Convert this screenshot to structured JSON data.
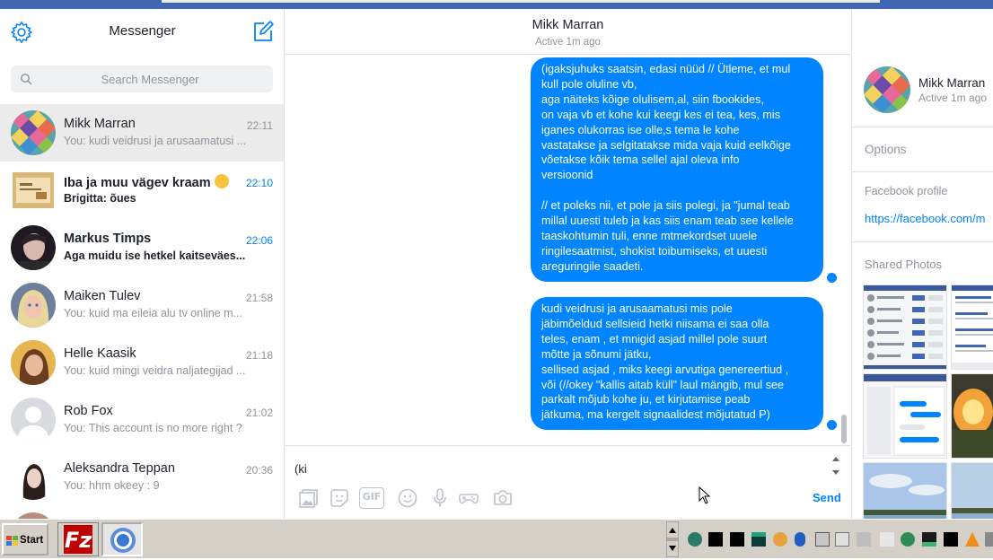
{
  "sidebar": {
    "title": "Messenger",
    "search_placeholder": "Search Messenger",
    "conversations": [
      {
        "name": "Mikk Marran",
        "snippet": "You: kudi veidrusi ja arusaamatusi ...",
        "time": "22:11",
        "selected": true,
        "unread": false
      },
      {
        "name": "Iba ja muu vägev kraam",
        "snippet": "Brigitta: õues",
        "time": "22:10",
        "selected": false,
        "unread": true
      },
      {
        "name": "Markus Timps",
        "snippet": "Aga muidu ise hetkel kaitseväes...",
        "time": "22:06",
        "selected": false,
        "unread": true
      },
      {
        "name": "Maiken Tulev",
        "snippet": "You: kuid ma eileia alu tv online m...",
        "time": "21:58",
        "selected": false,
        "unread": false
      },
      {
        "name": "Helle Kaasik",
        "snippet": "You: kuid mingi veidra naljategijad ...",
        "time": "21:18",
        "selected": false,
        "unread": false
      },
      {
        "name": "Rob Fox",
        "snippet": "You: This account is no more right ?",
        "time": "21:02",
        "selected": false,
        "unread": false
      },
      {
        "name": "Aleksandra Teppan",
        "snippet": "You: hhm okeey : 9",
        "time": "20:36",
        "selected": false,
        "unread": false
      }
    ]
  },
  "chat": {
    "name": "Mikk Marran",
    "status": "Active 1m ago",
    "messages": [
      {
        "text": "(igaksjuhuks saatsin, edasi nüüd // Ütleme, et mul\nkull pole oluline vb,\naga näiteks kõige olulisem,al, siin fbookides,\non vaja vb et kohe kui keegi kes ei tea, kes, mis\niganes olukorras ise olle,s tema le kohe\nvastatakse ja selgitatakse mida vaja kuid eelkõige\nvõetakse kõik tema sellel ajal oleva info\nversioonid\n\n// et poleks nii, et pole ja siis polegi, ja \"jumal teab\nmillal uuesti tuleb ja kas siis enam teab see kellele\ntaaskohtumin tuli, enne mtmekordset uuele\nringilesaatmist, shokist toibumiseks, et uuesti\nareguringile saadeti."
      },
      {
        "text": "kudi veidrusi ja arusaamatusi mis pole\njäbimõeldud sellsieid hetki niisama ei saa olla\nteles, enam , et mnigid asjad millel pole suurt\nmõtte ja sõnumi jätku,\nsellised asjad , miks keegi arvutiga genereertiud ,\nvõi (//okey \"kallis aitab küll\" laul mängib, mul see\nparkalt mõjub kohe ju, et kirjutamise peab\njätkuma, ma kergelt signaalidest mõjutatud P)"
      }
    ],
    "composer_value": "(ki",
    "send_label": "Send",
    "tools": [
      "photo-icon",
      "sticker-icon",
      "gif-icon",
      "emoji-icon",
      "microphone-icon",
      "game-icon",
      "camera-icon"
    ],
    "gif_label": "GIF"
  },
  "profile": {
    "name": "Mikk Marran",
    "status": "Active 1m ago",
    "options_label": "Options",
    "facebook_profile_label": "Facebook profile",
    "facebook_profile_link": "https://facebook.com/m",
    "shared_photos_label": "Shared Photos"
  },
  "taskbar": {
    "start_label": "Start"
  },
  "colors": {
    "accent": "#0084ff",
    "selected_row": "#ebebeb",
    "taskbar": "#d4d0c8"
  }
}
